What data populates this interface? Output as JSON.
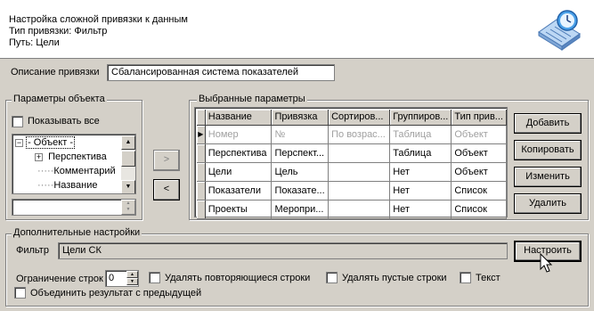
{
  "header": {
    "title": "Настройка сложной привязки к данным",
    "binding_type": "Тип привязки: Фильтр",
    "path": "Путь:   Цели"
  },
  "binding_description": {
    "label": "Описание привязки",
    "value": "Сбалансированная система показателей"
  },
  "object_params": {
    "title": "Параметры объекта",
    "show_all_label": "Показывать все",
    "tree": [
      {
        "label": "Объект",
        "expander": "−"
      },
      {
        "label": "Перспектива",
        "expander": "+"
      },
      {
        "label": "Комментарий",
        "expander": ""
      },
      {
        "label": "Название",
        "expander": ""
      }
    ],
    "lookup_value": ""
  },
  "move": {
    "add_arrow": ">",
    "remove_arrow": "<"
  },
  "selected_params": {
    "title": "Выбранные параметры",
    "columns": [
      "Название",
      "Привязка",
      "Сортиров...",
      "Группиров...",
      "Тип прив..."
    ],
    "new_row": {
      "indicator": "▶",
      "cells": [
        "Номер",
        "№",
        "По возрас...",
        "Таблица",
        "Объект"
      ]
    },
    "rows": [
      [
        "Перспектива",
        "Перспект...",
        "",
        "Таблица",
        "Объект"
      ],
      [
        "Цели",
        "Цель",
        "",
        "Нет",
        "Объект"
      ],
      [
        "Показатели",
        "Показате...",
        "",
        "Нет",
        "Список"
      ],
      [
        "Проекты",
        "Меропри...",
        "",
        "Нет",
        "Список"
      ]
    ]
  },
  "buttons": {
    "add": "Добавить",
    "copy": "Копировать",
    "edit": "Изменить",
    "delete": "Удалить",
    "configure": "Настроить"
  },
  "additional": {
    "title": "Дополнительные настройки",
    "filter_label": "Фильтр",
    "filter_value": "Цели СК",
    "row_limit_label": "Ограничение строк",
    "row_limit_value": "0",
    "remove_duplicates_label": "Удалять повторяющиеся строки",
    "remove_empty_label": "Удалять пустые строки",
    "text_label": "Текст",
    "merge_label": "Объединить результат с предыдущей"
  },
  "icons": {
    "header_icon": "calendar-clock-icon",
    "cursor": "mouse-pointer-icon"
  }
}
